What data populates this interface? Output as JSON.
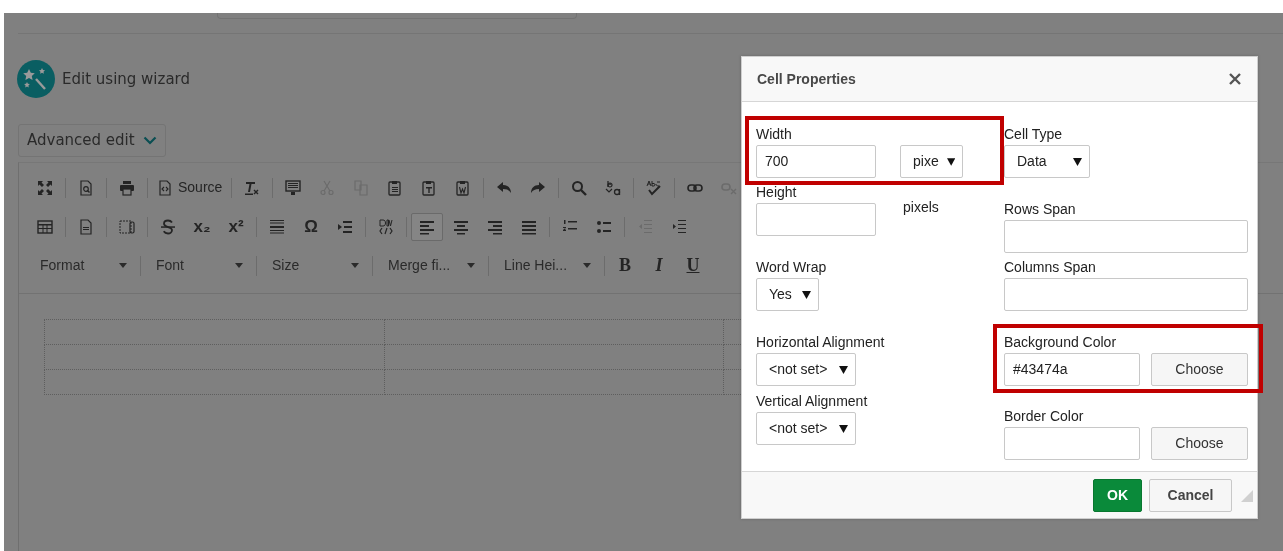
{
  "page": {
    "wizard_link": "Edit using wizard",
    "mode_button": "Advanced edit"
  },
  "toolbar": {
    "source": "Source",
    "symbols": [
      "x₂",
      "x²",
      "Ω"
    ],
    "edit_buttons": [
      {
        "disabled": true
      },
      {
        "disabled": true
      },
      {
        "disabled": false
      },
      {
        "disabled": false
      },
      {
        "disabled": false
      }
    ],
    "link_buttons": [
      {
        "disabled": false
      },
      {
        "disabled": true
      }
    ],
    "alignment_buttons": [
      {
        "selected": true
      },
      {
        "selected": false
      },
      {
        "selected": false
      },
      {
        "selected": false
      }
    ],
    "indent_buttons": [
      {
        "disabled": true
      },
      {
        "disabled": false
      }
    ],
    "combos": [
      "Format",
      "Font",
      "Size",
      "Merge fi...",
      "Line Hei..."
    ],
    "style_buttons": [
      "B",
      "I",
      "U"
    ]
  },
  "dialog": {
    "title": "Cell Properties",
    "left": [
      {
        "kind": "text_unit",
        "label": "Width",
        "value": "700",
        "unit": "pixe",
        "highlighted": true
      },
      {
        "kind": "text_note",
        "label": "Height",
        "note": "pixels",
        "highlighted": false
      },
      {
        "kind": "select",
        "label": "Word Wrap",
        "value": "Yes",
        "highlighted": false
      },
      {
        "kind": "select",
        "label": "Horizontal Alignment",
        "value": "<not set>",
        "highlighted": false
      },
      {
        "kind": "select",
        "label": "Vertical Alignment",
        "value": "<not set>",
        "highlighted": false
      }
    ],
    "right": [
      {
        "kind": "select",
        "label": "Cell Type",
        "value": "Data",
        "highlighted": false
      },
      {
        "kind": "text",
        "label": "Rows Span",
        "highlighted": false
      },
      {
        "kind": "text",
        "label": "Columns Span",
        "highlighted": false
      },
      {
        "kind": "color",
        "label": "Background Color",
        "value": "#43474a",
        "button": "Choose",
        "highlighted": true
      },
      {
        "kind": "color",
        "label": "Border Color",
        "button": "Choose",
        "highlighted": false
      }
    ],
    "buttons": [
      {
        "label": "OK",
        "kind": "primary"
      },
      {
        "label": "Cancel",
        "kind": "secondary"
      }
    ]
  }
}
